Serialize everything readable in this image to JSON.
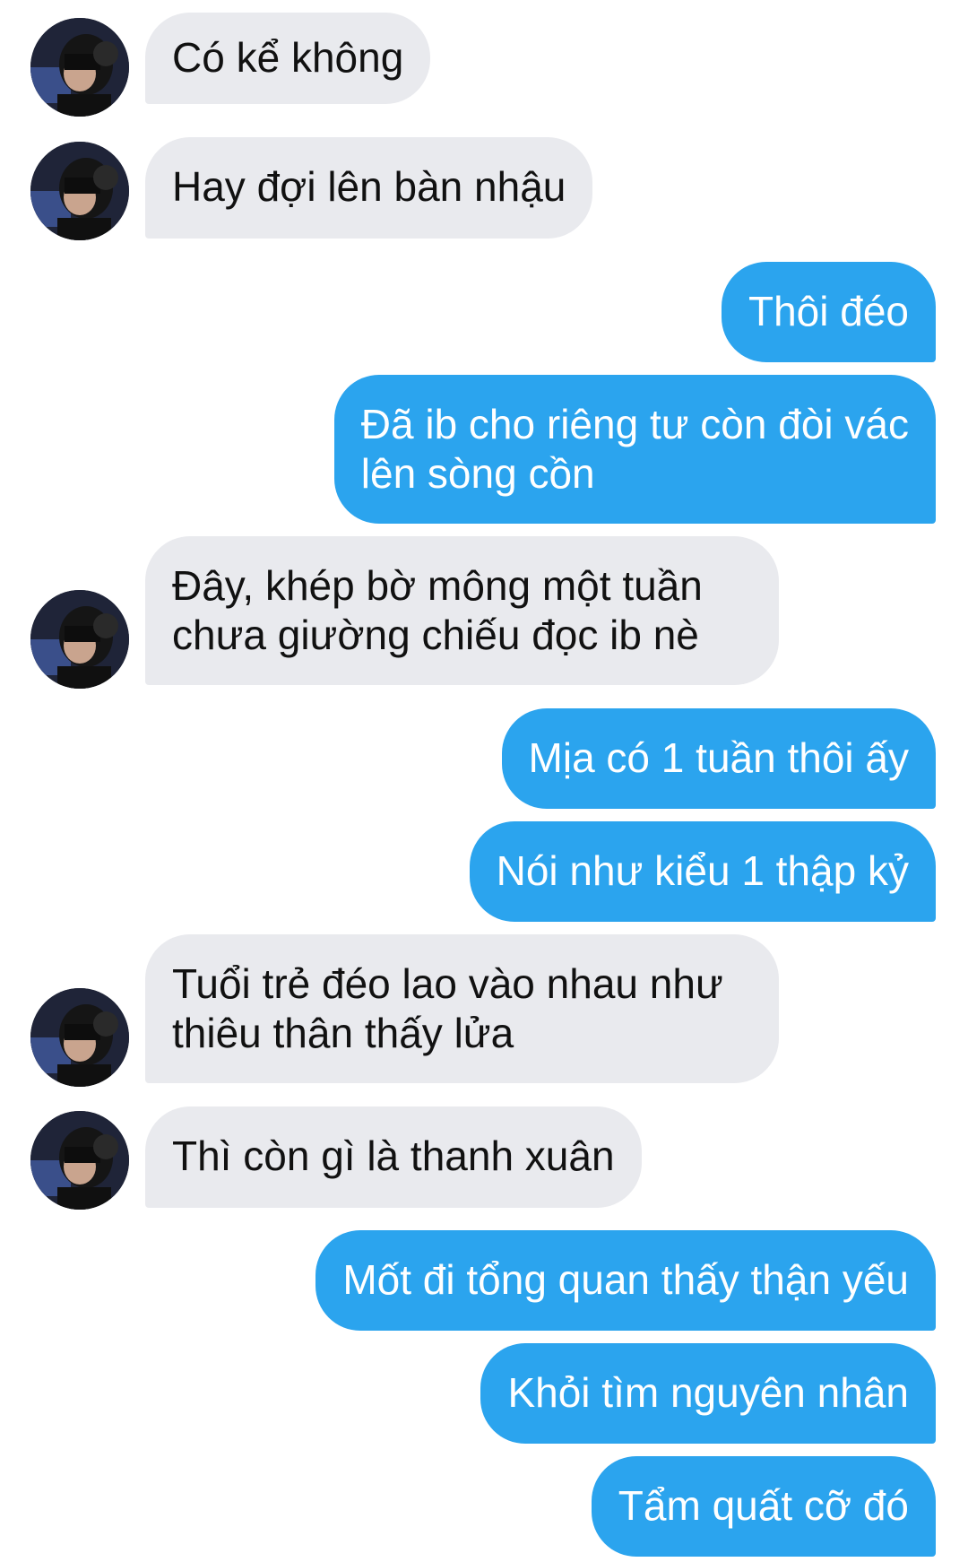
{
  "messages": [
    {
      "side": "incoming",
      "lines": [
        "Có kể không"
      ]
    },
    {
      "side": "incoming",
      "lines": [
        "Hay đợi lên bàn nhậu"
      ]
    },
    {
      "side": "outgoing",
      "lines": [
        "Thôi đéo"
      ]
    },
    {
      "side": "outgoing",
      "lines": [
        "Đã ib cho riêng tư còn đòi vác",
        "lên sòng cồn"
      ]
    },
    {
      "side": "incoming",
      "lines": [
        "Đây, khép bờ mông một tuần",
        "chưa giường chiếu đọc ib nè"
      ]
    },
    {
      "side": "outgoing",
      "lines": [
        "Mịa có 1 tuần thôi ấy"
      ]
    },
    {
      "side": "outgoing",
      "lines": [
        "Nói như kiểu 1 thập kỷ"
      ]
    },
    {
      "side": "incoming",
      "lines": [
        "Tuổi trẻ đéo lao vào nhau như",
        "thiêu thân thấy lửa"
      ]
    },
    {
      "side": "incoming",
      "lines": [
        "Thì còn gì là thanh xuân"
      ]
    },
    {
      "side": "outgoing",
      "lines": [
        "Mốt đi tổng quan thấy thận yếu"
      ]
    },
    {
      "side": "outgoing",
      "lines": [
        "Khỏi tìm nguyên nhân"
      ]
    },
    {
      "side": "outgoing",
      "lines": [
        "Tẩm quất cỡ đó"
      ]
    }
  ],
  "colors": {
    "incoming_bubble": "#e9eaee",
    "outgoing_bubble": "#2ba4ee",
    "incoming_text": "#111111",
    "outgoing_text": "#ffffff"
  }
}
